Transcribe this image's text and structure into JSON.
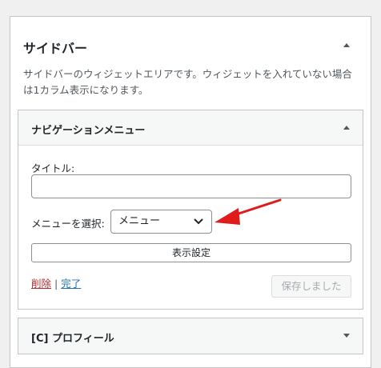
{
  "sidebar": {
    "title": "サイドバー",
    "description": "サイドバーのウィジェットエリアです。ウィジェットを入れていない場合は1カラム表示になります。"
  },
  "nav_widget": {
    "title": "ナビゲーションメニュー",
    "title_label": "タイトル:",
    "title_value": "",
    "menu_label": "メニューを選択:",
    "menu_selected": "メニュー",
    "display_settings": "表示設定",
    "delete": "削除",
    "separator": "|",
    "done": "完了",
    "saved": "保存しました"
  },
  "profile_widget": {
    "title": "[C] プロフィール"
  },
  "icons": {
    "collapse": "caret-up-icon",
    "expand": "caret-down-icon",
    "select": "chevron-down-icon",
    "annotation": "red-arrow-icon"
  },
  "colors": {
    "delete_link": "#b32d2e",
    "done_link": "#2271b1",
    "annotation_arrow": "#e01b1b"
  }
}
